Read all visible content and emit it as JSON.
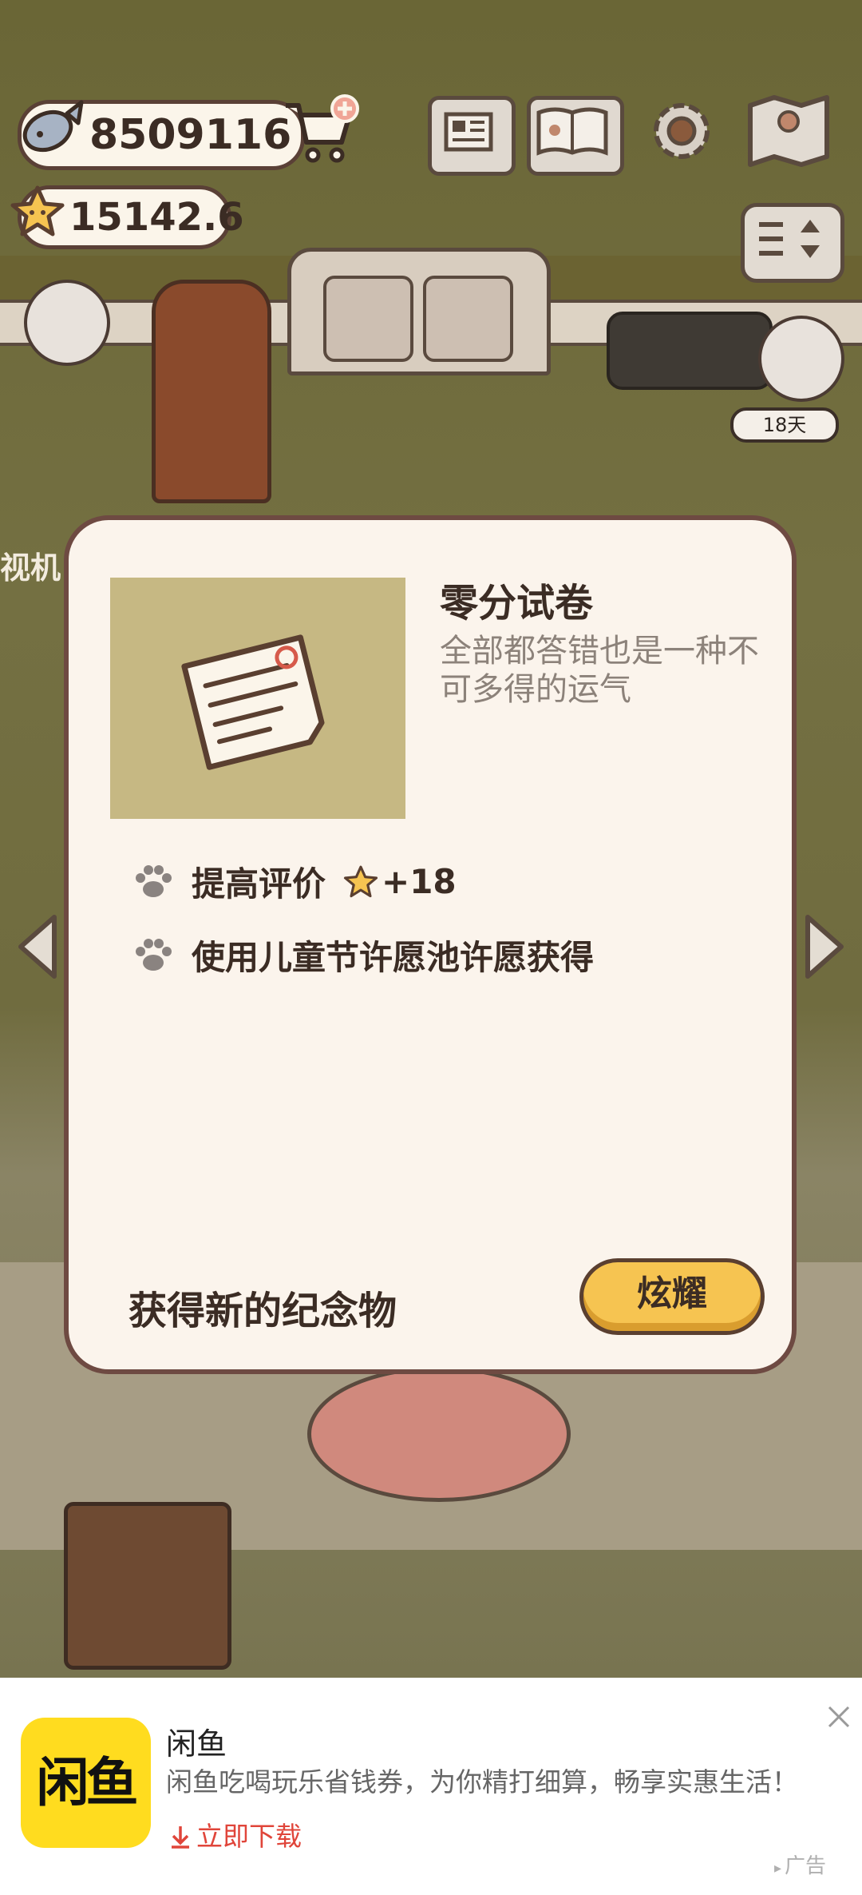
{
  "hud": {
    "fish_count": "8509116",
    "star_rating": "15142.6",
    "day_badge": "18天",
    "edge_label": "视机",
    "icons": [
      "fish-icon",
      "cart-plus-icon",
      "star-icon",
      "newspaper-icon",
      "cat-book-icon",
      "gear-icon",
      "map-icon",
      "sort-toggle-icon"
    ]
  },
  "modal": {
    "item_name": "零分试卷",
    "item_description": "全部都答错也是一种不可多得的运气",
    "effects": [
      {
        "label": "提高评价",
        "reward": "+18"
      },
      {
        "label": "使用儿童节许愿池许愿获得"
      }
    ],
    "footer_message": "获得新的纪念物",
    "show_off_label": "炫耀"
  },
  "ad": {
    "logo_text": "闲鱼",
    "title": "闲鱼",
    "description": "闲鱼吃喝玩乐省钱券，为你精打细算，畅享实惠生活！",
    "cta": "立即下载",
    "tag": "广告"
  },
  "colors": {
    "modal_bg": "#fbf4ec",
    "modal_border": "#6e4a42",
    "button_yellow": "#f6c451",
    "item_frame": "#c6b883",
    "ad_logo": "#ffdc1f",
    "ad_cta": "#e0453a"
  }
}
